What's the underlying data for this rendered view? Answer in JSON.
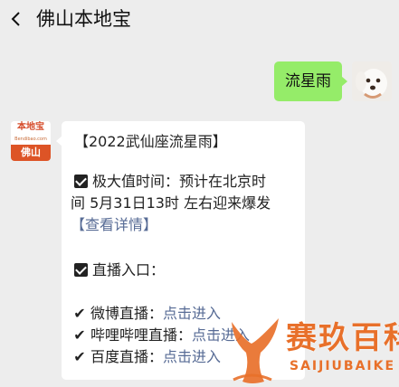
{
  "header": {
    "title": "佛山本地宝"
  },
  "chat": {
    "user_message": "流星雨",
    "bot_logo": {
      "top": "本地宝",
      "sub": "Bendibao.com",
      "city": "佛山"
    },
    "bot_message": {
      "title": "【2022武仙座流星雨】",
      "peak_line1": "极大值时间：预计在北京时",
      "peak_line2": "间 5月31日13时 左右迎来爆发",
      "details_link": "【查看详情】",
      "live_heading": "直播入口：",
      "streams": [
        {
          "label": "微博直播：",
          "link": "点击进入"
        },
        {
          "label": "哔哩哔哩直播：",
          "link": "点击进入"
        },
        {
          "label": "百度直播：",
          "link": "点击进入"
        }
      ]
    }
  },
  "watermark": {
    "name": "赛玖百科",
    "pinyin": "SAIJIUBAIKE",
    "color": "#e8702a"
  }
}
